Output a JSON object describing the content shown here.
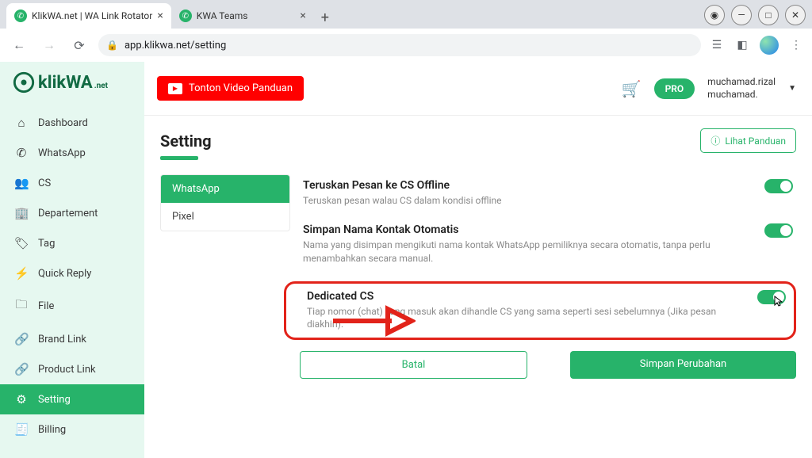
{
  "browser": {
    "tabs": [
      {
        "title": "KlikWA.net | WA Link Rotator",
        "active": true
      },
      {
        "title": "KWA Teams",
        "active": false
      }
    ],
    "url": "app.klikwa.net/setting"
  },
  "logo": {
    "main": "klikWA",
    "sub": ".net"
  },
  "sidebar": {
    "items": [
      {
        "icon": "⌂",
        "label": "Dashboard"
      },
      {
        "icon": "✆",
        "label": "WhatsApp"
      },
      {
        "icon": "👥",
        "label": "CS"
      },
      {
        "icon": "🏢",
        "label": "Departement"
      },
      {
        "icon": "🏷",
        "label": "Tag"
      },
      {
        "icon": "⚡",
        "label": "Quick Reply"
      },
      {
        "icon": "🗀",
        "label": "File"
      },
      {
        "icon": "🔗",
        "label": "Brand Link"
      },
      {
        "icon": "🔗",
        "label": "Product Link"
      },
      {
        "icon": "⚙",
        "label": "Setting"
      },
      {
        "icon": "🧾",
        "label": "Billing"
      }
    ],
    "activeIndex": 9
  },
  "topbar": {
    "videoLabel": "Tonton Video Panduan",
    "badge": "PRO",
    "userLine1": "muchamad.rizal",
    "userLine2": "muchamad."
  },
  "page": {
    "title": "Setting",
    "panduanLabel": "Lihat Panduan"
  },
  "verticalTabs": {
    "items": [
      "WhatsApp",
      "Pixel"
    ],
    "activeIndex": 0
  },
  "options": [
    {
      "title": "Teruskan Pesan ke CS Offline",
      "desc": "Teruskan pesan walau CS dalam kondisi offline",
      "on": true
    },
    {
      "title": "Simpan Nama Kontak Otomatis",
      "desc": "Nama yang disimpan mengikuti nama kontak WhatsApp pemiliknya secara otomatis, tanpa perlu menambahkan secara manual.",
      "on": true
    },
    {
      "title": "Dedicated CS",
      "desc": "Tiap nomor (chat) yang masuk akan dihandle CS yang sama seperti sesi sebelumnya (Jika pesan diakhiri).",
      "on": true,
      "highlighted": true
    }
  ],
  "actions": {
    "cancel": "Batal",
    "save": "Simpan Perubahan"
  }
}
